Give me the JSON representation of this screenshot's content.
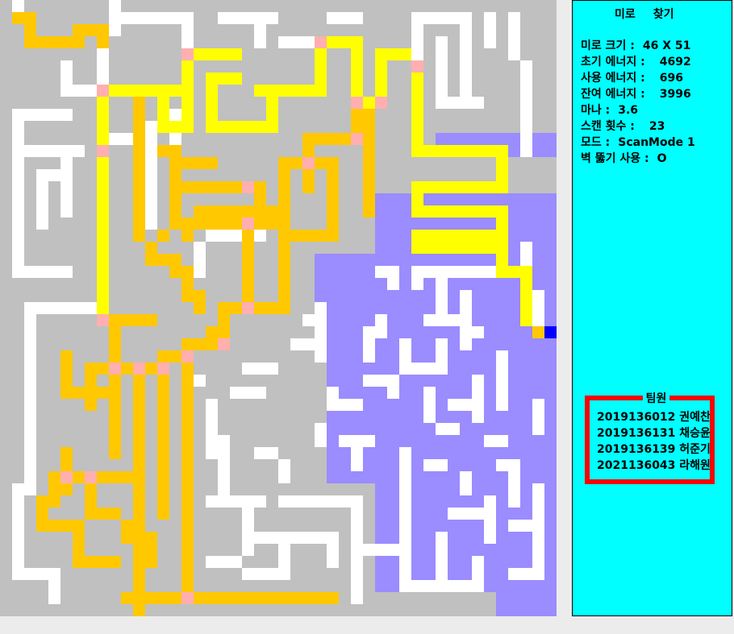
{
  "panel": {
    "title_part1": "미로",
    "title_part2": "찾기",
    "stats": [
      {
        "label": "미로 크기 :",
        "value": "46 X 51"
      },
      {
        "label": "초기 에너지 :",
        "value": "4692"
      },
      {
        "label": "사용 에너지 :",
        "value": "696"
      },
      {
        "label": "잔여 에너지 :",
        "value": "3996"
      },
      {
        "label": "마나 :",
        "value": "3.6"
      },
      {
        "label": "스캔 횟수 :",
        "value": "23"
      },
      {
        "label": "모드 :",
        "value": "ScanMode 1"
      },
      {
        "label": "벽 뚫기 사용 :",
        "value": "O"
      }
    ],
    "team_title": "팀원",
    "team_members": [
      "2019136012 권예찬",
      "2019136131 채승윤",
      "2019136139 허준기",
      "2021136043 라해원"
    ]
  },
  "colors": {
    "wall": "#c0c0c0",
    "open": "#ffffff",
    "path_current": "#ffff00",
    "path_explored": "#ffc800",
    "junction": "#ffafaf",
    "scanned": "#9b8cff",
    "player": "#0000ff",
    "panel_bg": "#00ffff",
    "team_border": "#ff0000"
  },
  "maze": {
    "cols": 46,
    "rows": 51
  }
}
